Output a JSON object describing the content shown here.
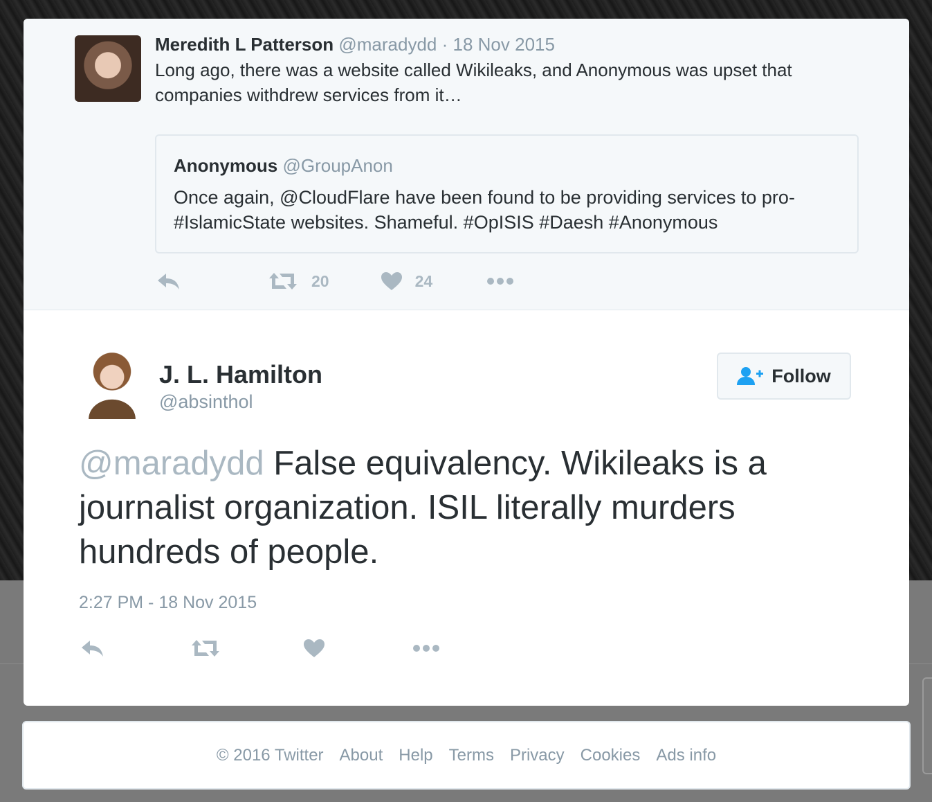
{
  "parent_tweet": {
    "author_name": "Meredith L Patterson",
    "author_handle": "@maradydd",
    "separator": "·",
    "date": "18 Nov 2015",
    "text": "Long ago, there was a website called Wikileaks, and Anonymous was upset that companies withdrew services from it…",
    "quoted": {
      "author_name": "Anonymous",
      "author_handle": "@GroupAnon",
      "text": "Once again, @CloudFlare have been found to be providing services to pro-#IslamicState websites. Shameful. #OpISIS #Daesh #Anonymous"
    },
    "actions": {
      "retweet_count": "20",
      "like_count": "24"
    }
  },
  "main_tweet": {
    "author_name": "J. L. Hamilton",
    "author_handle": "@absinthol",
    "follow_label": "Follow",
    "mention": "@maradydd",
    "text": " False equivalency. Wikileaks is a journalist organization. ISIL literally murders hundreds of people.",
    "timestamp": "2:27 PM - 18 Nov 2015"
  },
  "footer": {
    "copyright": "© 2016 Twitter",
    "links": [
      "About",
      "Help",
      "Terms",
      "Privacy",
      "Cookies",
      "Ads info"
    ]
  },
  "colors": {
    "text": "#292f33",
    "muted": "#8899a6",
    "icon": "#aab8c2",
    "follow_icon": "#1da1f2"
  },
  "icons": [
    "reply-icon",
    "retweet-icon",
    "heart-icon",
    "more-icon",
    "follow-user-icon"
  ]
}
